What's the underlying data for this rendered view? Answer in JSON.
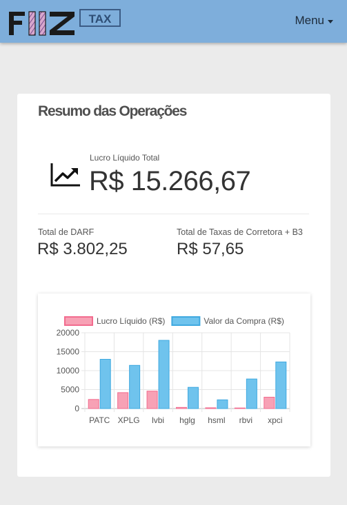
{
  "header": {
    "logo_text": "FIIZ TAX",
    "menu_label": "Menu"
  },
  "summary": {
    "title": "Resumo das Operações",
    "lucro_label": "Lucro Líquido Total",
    "lucro_value": "R$ 15.266,67",
    "darf_label": "Total de DARF",
    "darf_value": "R$ 3.802,25",
    "taxas_label": "Total de Taxas de Corretora + B3",
    "taxas_value": "R$ 57,65"
  },
  "colors": {
    "navbar": "#7eaedb",
    "series_lucro": "#f7a1b5",
    "series_compra": "#6fc3ed"
  },
  "chart_data": {
    "type": "bar",
    "categories": [
      "PATC",
      "XPLG",
      "lvbi",
      "hglg",
      "hsml",
      "rbvi",
      "xpci"
    ],
    "series": [
      {
        "name": "Lucro Líquido (R$)",
        "color": "#f7a1b5",
        "border": "#f26b8e",
        "values": [
          2400,
          4200,
          4600,
          300,
          200,
          150,
          3000
        ]
      },
      {
        "name": "Valor da Compra (R$)",
        "color": "#6fc3ed",
        "border": "#3fa9e0",
        "values": [
          13000,
          11400,
          18000,
          5600,
          2300,
          7800,
          12300
        ]
      }
    ],
    "yticks": [
      "20000",
      "15000",
      "10000",
      "5000",
      "0"
    ],
    "ylim": [
      0,
      20000
    ],
    "legend": "top",
    "grid": true
  }
}
